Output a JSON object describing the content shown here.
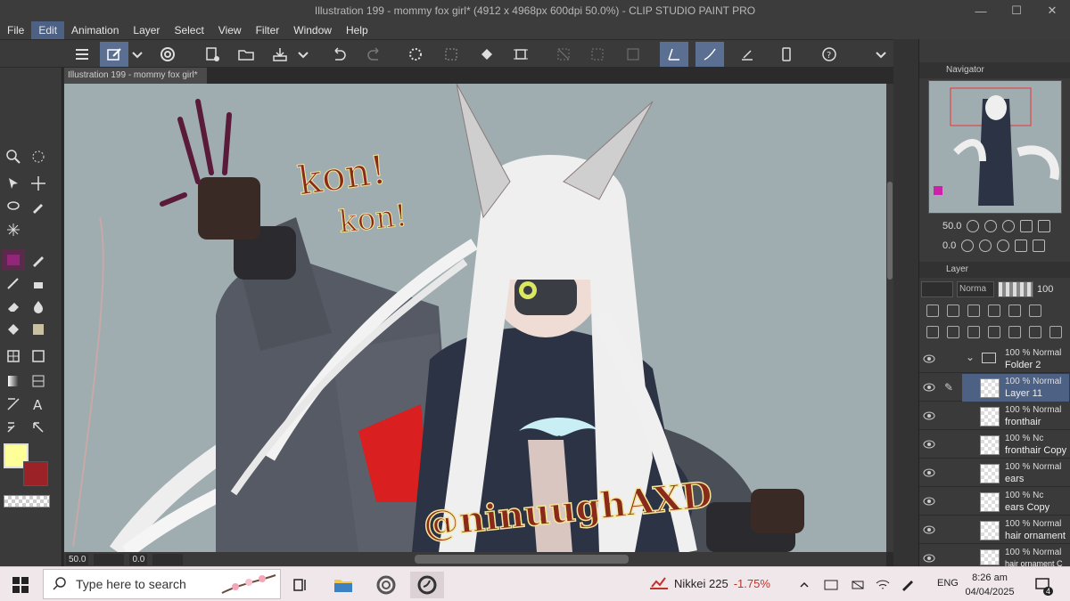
{
  "window": {
    "title": "Illustration 199 - mommy fox girl* (4912 x 4968px 600dpi 50.0%)  - CLIP STUDIO PAINT PRO",
    "minimize": "—",
    "maximize": "☐",
    "close": "✕"
  },
  "menu": [
    "File",
    "Edit",
    "Animation",
    "Layer",
    "Select",
    "View",
    "Filter",
    "Window",
    "Help"
  ],
  "menu_active": "Edit",
  "document_tab": "Illustration 199 - mommy fox girl*",
  "canvas_text": {
    "kon1": "kon!",
    "kon2": "kon!",
    "watermark": "@ninuughAXD"
  },
  "canvas_status": {
    "zoom": "50.0",
    "angle": "0.0"
  },
  "navigator": {
    "title": "Navigator",
    "zoom": "50.0",
    "rotation": "0.0"
  },
  "layer_panel": {
    "title": "Layer",
    "blend_mode": "Norma",
    "opacity": "100"
  },
  "layers": [
    {
      "mode": "100 % Normal",
      "name": "Folder 2",
      "folder": true
    },
    {
      "mode": "100 % Normal",
      "name": "Layer 11",
      "selected": true
    },
    {
      "mode": "100 % Normal",
      "name": "fronthair"
    },
    {
      "mode": "100 % Nc",
      "name": "fronthair Copy"
    },
    {
      "mode": "100 % Normal",
      "name": "ears"
    },
    {
      "mode": "100 % Nc",
      "name": "ears Copy"
    },
    {
      "mode": "100 % Normal",
      "name": "hair ornament"
    },
    {
      "mode": "100 % Normal",
      "name": "hair ornament C"
    }
  ],
  "colors": {
    "main": "#ffff99",
    "sub": "#9b2226",
    "accent": "#4d6184"
  },
  "taskbar": {
    "search_placeholder": "Type here to search",
    "ticker_name": "Nikkei 225",
    "ticker_change": "-1.75%",
    "lang": "ENG",
    "time": "8:26 am",
    "date": "04/04/2025",
    "notifications": "4"
  }
}
